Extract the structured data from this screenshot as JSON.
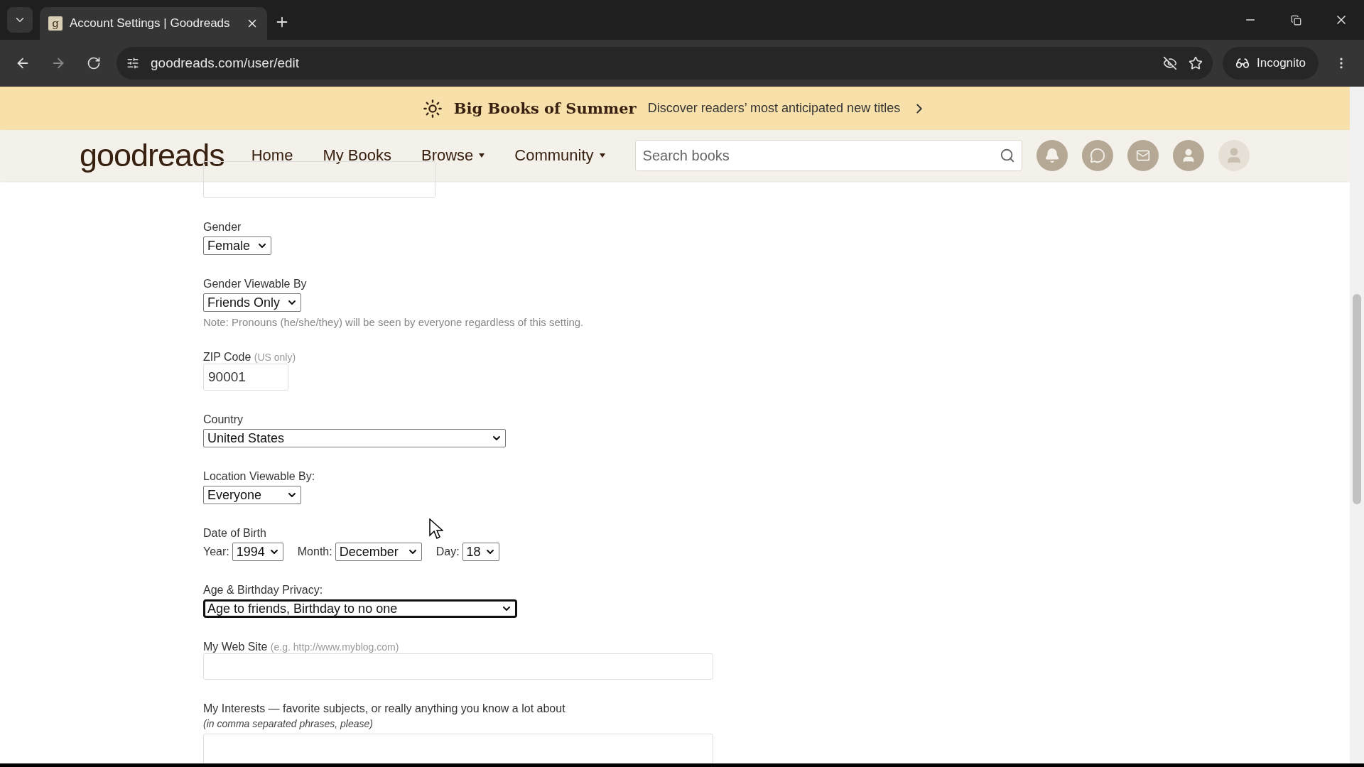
{
  "browser": {
    "tab": {
      "favicon": "g",
      "title": "Account Settings | Goodreads"
    },
    "url": "goodreads.com/user/edit",
    "profile": "Incognito"
  },
  "banner": {
    "title": "Big Books of Summer",
    "text": "Discover readers’ most anticipated new titles"
  },
  "nav": {
    "logo": "goodreads",
    "links": [
      {
        "label": "Home",
        "dropdown": false
      },
      {
        "label": "My Books",
        "dropdown": false
      },
      {
        "label": "Browse",
        "dropdown": true
      },
      {
        "label": "Community",
        "dropdown": true
      }
    ],
    "search": {
      "placeholder": "Search books"
    }
  },
  "form": {
    "fields": [
      {
        "kind": "input"
      },
      {
        "kind": "select",
        "label": "Gender",
        "value": "Female",
        "focused": false
      },
      {
        "kind": "select",
        "label": "Gender Viewable By",
        "value": "Friends Only",
        "focused": false,
        "note": "Note: Pronouns (he/she/they) will be seen by everyone regardless of this setting."
      },
      {
        "kind": "input",
        "label": "ZIP Code",
        "hint": "(US only)",
        "value": "90001"
      },
      {
        "kind": "select",
        "label": "Country",
        "value": "United States",
        "focused": false
      },
      {
        "kind": "select",
        "label": "Location Viewable By:",
        "value": "Everyone",
        "focused": false
      },
      {
        "kind": "date",
        "label": "Date of Birth",
        "parts": [
          {
            "label": "Year:",
            "value": "1994"
          },
          {
            "label": "Month:",
            "value": "December"
          },
          {
            "label": "Day:",
            "value": "18"
          }
        ]
      },
      {
        "kind": "select",
        "label": "Age & Birthday Privacy:",
        "value": "Age to friends, Birthday to no one",
        "focused": true
      },
      {
        "kind": "input",
        "label": "My Web Site",
        "hint": "(e.g. http://www.myblog.com)"
      },
      {
        "kind": "textarea",
        "label": "My Interests — favorite subjects, or really anything you know a lot about",
        "note": "(in comma separated phrases, please)"
      }
    ]
  }
}
